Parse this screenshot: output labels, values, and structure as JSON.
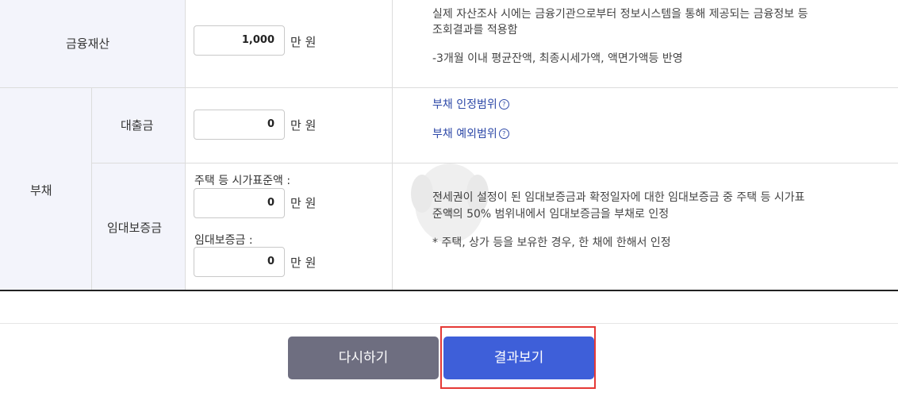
{
  "financial": {
    "label": "금융재산",
    "value": "1,000",
    "unit": "만 원",
    "desc_line1": "실제 자산조사 시에는 금융기관으로부터 정보시스템을 통해 제공되는 금융정보 등",
    "desc_line2": "조회결과를 적용함",
    "desc_line3": "-3개월 이내 평균잔액, 최종시세가액, 액면가액등 반영"
  },
  "debt": {
    "label": "부채",
    "loan": {
      "label": "대출금",
      "value": "0",
      "unit": "만 원",
      "link1": "부채 인정범위",
      "link2": "부채 예외범위"
    },
    "deposit": {
      "label": "임대보증금",
      "field1_label": "주택 등 시가표준액 :",
      "field1_value": "0",
      "field1_unit": "만 원",
      "field2_label": "임대보증금 :",
      "field2_value": "0",
      "field2_unit": "만 원",
      "desc_line1": "전세권이 설정이 된 임대보증금과 확정일자에 대한 임대보증금 중 주택 등 시가표",
      "desc_line2": "준액의 50% 범위내에서 임대보증금을 부채로 인정",
      "desc_line3": "* 주택, 상가 등을 보유한 경우, 한 채에 한해서 인정"
    }
  },
  "buttons": {
    "reset_label": "다시하기",
    "result_label": "결과보기",
    "reset_color": "#6e6e80",
    "result_color": "#3e5fd9",
    "highlight_color": "#e53935"
  }
}
